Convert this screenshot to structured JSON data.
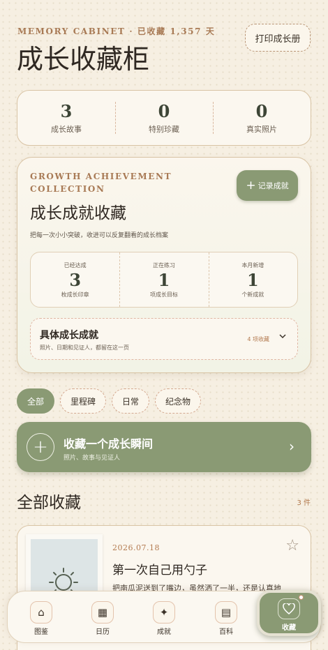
{
  "header": {
    "eyebrow": "MEMORY CABINET · 已收藏 1,357 天",
    "title": "成长收藏柜",
    "print_label": "打印成长册"
  },
  "stats": [
    {
      "value": "3",
      "label": "成长故事"
    },
    {
      "value": "0",
      "label": "特别珍藏"
    },
    {
      "value": "0",
      "label": "真实照片"
    }
  ],
  "achievement": {
    "eyebrow": "GROWTH ACHIEVEMENT COLLECTION",
    "title": "成长成就收藏",
    "subtitle": "把每一次小小突破，收进可以反复翻看的成长档案",
    "record_label": "记录成就",
    "metrics": [
      {
        "top": "已经达成",
        "value": "3",
        "bottom": "枚成长印章"
      },
      {
        "top": "正在练习",
        "value": "1",
        "bottom": "项成长目标"
      },
      {
        "top": "本月新增",
        "value": "1",
        "bottom": "个新成就"
      }
    ],
    "detail": {
      "title": "具体成长成就",
      "desc": "照片、日期和见证人，都留在这一页",
      "count": "4 项收藏"
    }
  },
  "filters": [
    "全部",
    "里程碑",
    "日常",
    "纪念物"
  ],
  "add_banner": {
    "title": "收藏一个成长瞬间",
    "subtitle": "照片、故事与见证人"
  },
  "section": {
    "title": "全部收藏",
    "count": "3 件"
  },
  "items": [
    {
      "date": "2026.07.18",
      "title": "第一次自己用勺子",
      "desc": "把南瓜泥送到了嘴边，虽然洒了一半，还是认真地"
    }
  ],
  "nav": [
    {
      "label": "图鉴",
      "icon": "home-icon"
    },
    {
      "label": "日历",
      "icon": "calendar-icon"
    },
    {
      "label": "成就",
      "icon": "sparkle-icon"
    },
    {
      "label": "百科",
      "icon": "book-icon"
    },
    {
      "label": "收藏",
      "icon": "heart-icon",
      "active": true
    }
  ],
  "colors": {
    "accent": "#8a9a74",
    "background": "#f6efe2",
    "eyebrow": "#a87a55"
  }
}
